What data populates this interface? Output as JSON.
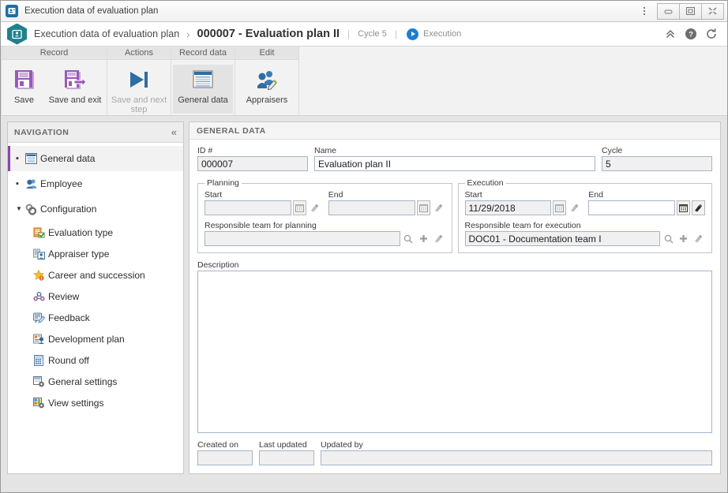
{
  "window": {
    "title": "Execution data of evaluation plan",
    "app_icon": "evaluation-plan-icon",
    "controls": {
      "menu": "window-menu",
      "minimize": "Minimize",
      "maximize": "Maximize",
      "close": "Close"
    }
  },
  "header": {
    "breadcrumb_root": "Execution data of evaluation plan",
    "separator": "›",
    "breadcrumb_current": "000007 - Evaluation plan II",
    "divider": "|",
    "cycle_label": "Cycle 5",
    "divider2": "|",
    "stage_label": "Execution",
    "collapse_icon": "chevron-double-up-icon",
    "help_icon": "help-icon",
    "refresh_icon": "refresh-icon"
  },
  "ribbon": {
    "groups": [
      {
        "title": "Record",
        "buttons": [
          {
            "label": "Save",
            "icon": "save-floppy-icon",
            "enabled": true,
            "selected": false,
            "wide": false
          },
          {
            "label": "Save and exit",
            "icon": "save-and-exit-icon",
            "enabled": true,
            "selected": false,
            "wide": true
          }
        ]
      },
      {
        "title": "Actions",
        "buttons": [
          {
            "label": "Save and next step",
            "icon": "next-step-icon",
            "enabled": false,
            "selected": false,
            "wide": true
          }
        ]
      },
      {
        "title": "Record data",
        "buttons": [
          {
            "label": "General data",
            "icon": "general-data-icon",
            "enabled": true,
            "selected": true,
            "wide": true
          }
        ]
      },
      {
        "title": "Edit",
        "buttons": [
          {
            "label": "Appraisers",
            "icon": "appraisers-icon",
            "enabled": true,
            "selected": false,
            "wide": false
          }
        ]
      }
    ]
  },
  "navigation": {
    "title": "NAVIGATION",
    "collapse_icon": "«",
    "items": [
      {
        "label": "General data",
        "icon": "general-data-icon",
        "level": 0,
        "marker": "▪",
        "selected": true
      },
      {
        "label": "Employee",
        "icon": "employee-icon",
        "level": 0,
        "marker": "▪",
        "selected": false
      },
      {
        "label": "Configuration",
        "icon": "configuration-gear-icon",
        "level": 0,
        "marker": "▼",
        "selected": false
      },
      {
        "label": "Evaluation type",
        "icon": "evaluation-type-icon",
        "level": 1,
        "marker": "",
        "selected": false
      },
      {
        "label": "Appraiser type",
        "icon": "appraiser-type-icon",
        "level": 1,
        "marker": "",
        "selected": false
      },
      {
        "label": "Career and succession",
        "icon": "career-star-icon",
        "level": 1,
        "marker": "",
        "selected": false
      },
      {
        "label": "Review",
        "icon": "review-icon",
        "level": 1,
        "marker": "",
        "selected": false
      },
      {
        "label": "Feedback",
        "icon": "feedback-icon",
        "level": 1,
        "marker": "",
        "selected": false
      },
      {
        "label": "Development plan",
        "icon": "development-plan-icon",
        "level": 1,
        "marker": "",
        "selected": false
      },
      {
        "label": "Round off",
        "icon": "round-off-calculator-icon",
        "level": 1,
        "marker": "",
        "selected": false
      },
      {
        "label": "General settings",
        "icon": "general-settings-icon",
        "level": 1,
        "marker": "",
        "selected": false
      },
      {
        "label": "View settings",
        "icon": "view-settings-icon",
        "level": 1,
        "marker": "",
        "selected": false
      }
    ]
  },
  "main": {
    "section_title": "GENERAL DATA",
    "fields": {
      "id_label": "ID #",
      "id_value": "000007",
      "name_label": "Name",
      "name_value": "Evaluation plan II",
      "cycle_label": "Cycle",
      "cycle_value": "5"
    },
    "planning": {
      "legend": "Planning",
      "start_label": "Start",
      "start_value": "",
      "end_label": "End",
      "end_value": "",
      "team_label": "Responsible team for planning",
      "team_value": "",
      "calendar_icon": "calendar-icon",
      "clear_icon": "clear-brush-icon",
      "search_icon": "search-magnifier-icon",
      "add_icon": "add-plus-icon"
    },
    "execution": {
      "legend": "Execution",
      "start_label": "Start",
      "start_value": "11/29/2018",
      "end_label": "End",
      "end_value": "",
      "team_label": "Responsible team for execution",
      "team_value": "DOC01 - Documentation team I",
      "calendar_icon": "calendar-icon",
      "clear_icon": "clear-brush-icon",
      "search_icon": "search-magnifier-icon",
      "add_icon": "add-plus-icon"
    },
    "description": {
      "label": "Description",
      "value": "",
      "placeholder": ""
    },
    "footer": {
      "created_label": "Created on",
      "created_value": "",
      "updated_label": "Last updated",
      "updated_value": "",
      "updated_by_label": "Updated by",
      "updated_by_value": ""
    }
  },
  "colors": {
    "accent_purple": "#8e44ad",
    "teal": "#20818d",
    "blue": "#1a7fd4",
    "field_border": "#a3b5c9",
    "field_bg": "#f0f0f0"
  }
}
